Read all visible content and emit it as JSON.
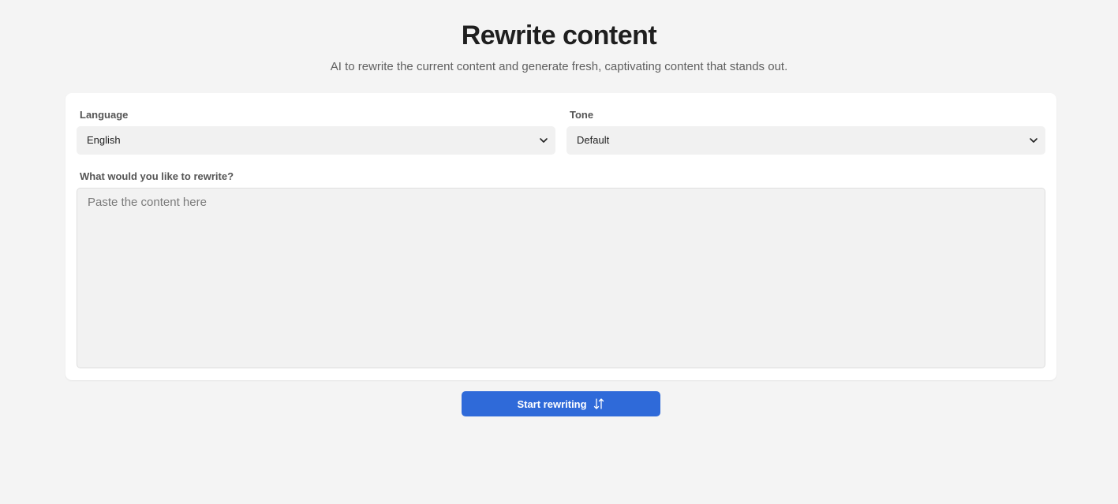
{
  "header": {
    "title": "Rewrite content",
    "subtitle": "AI to rewrite the current content and generate fresh, captivating content that stands out."
  },
  "form": {
    "language": {
      "label": "Language",
      "selected": "English",
      "icon": "chevron-down-icon"
    },
    "tone": {
      "label": "Tone",
      "selected": "Default",
      "icon": "chevron-down-icon"
    },
    "content": {
      "label": "What would you like to rewrite?",
      "value": "",
      "placeholder": "Paste the content here"
    }
  },
  "actions": {
    "start_label": "Start rewriting",
    "start_icon": "swap-vertical-icon"
  },
  "colors": {
    "page_background": "#f4f4f4",
    "card_background": "#ffffff",
    "input_background": "#f1f1f1",
    "primary": "#2f6ad9"
  }
}
